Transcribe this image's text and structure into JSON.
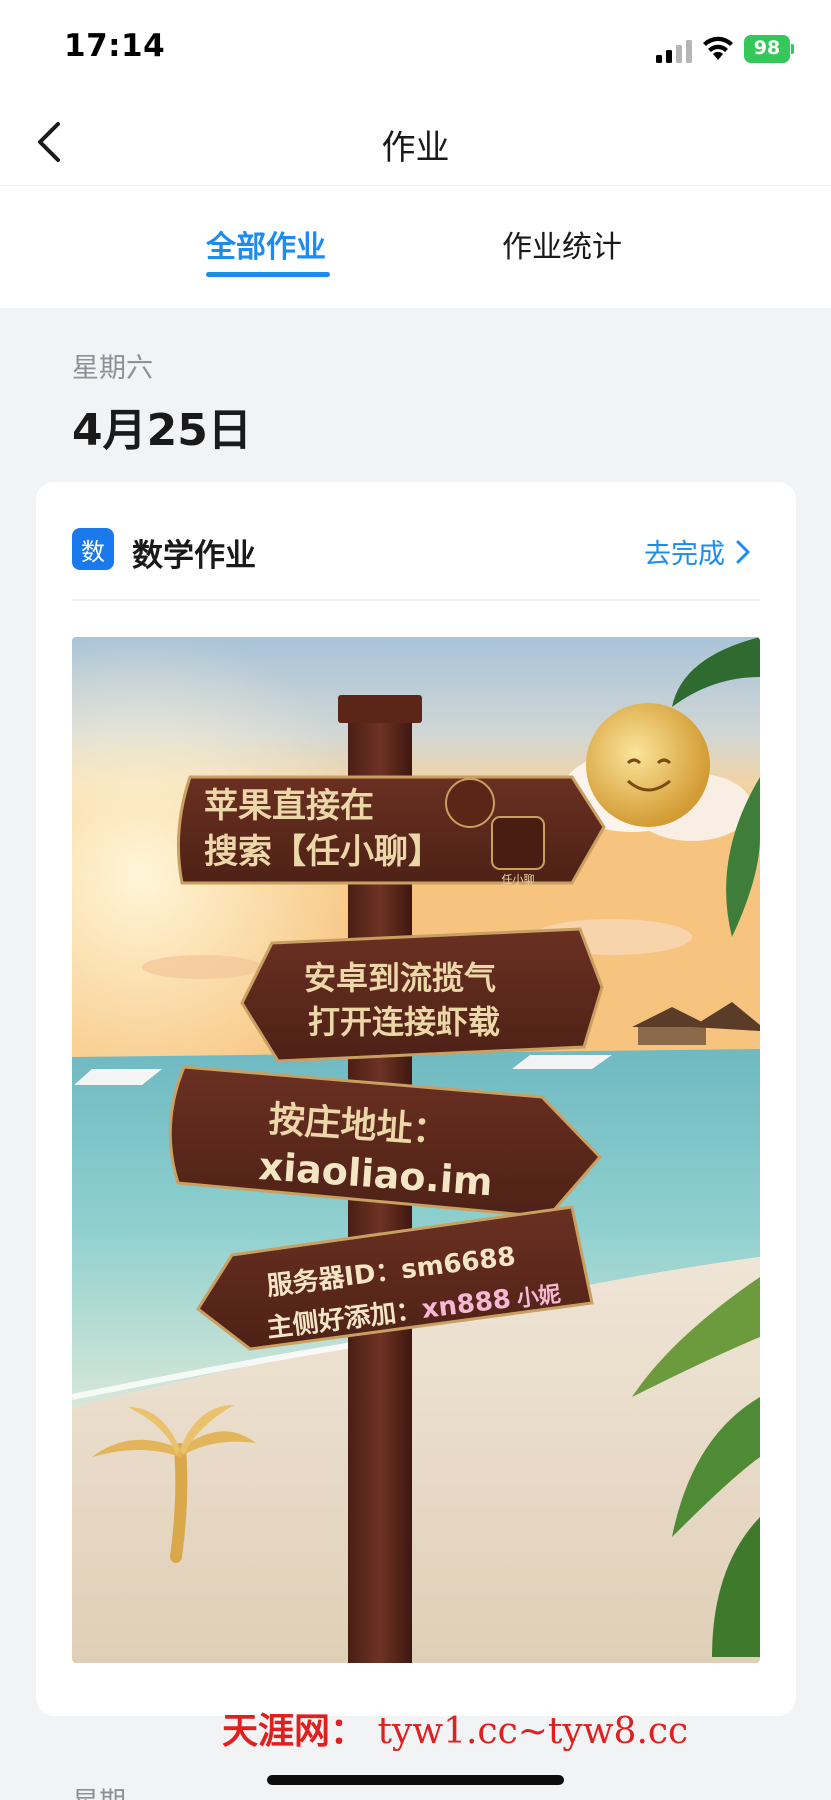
{
  "status_bar": {
    "time": "17:14",
    "battery": "98"
  },
  "nav": {
    "title": "作业"
  },
  "tabs": [
    {
      "label": "全部作业",
      "active": true
    },
    {
      "label": "作业统计",
      "active": false
    }
  ],
  "day": {
    "weekday": "星期六",
    "date": "4月25日"
  },
  "card": {
    "subject_icon_char": "数",
    "subject_name": "数学作业",
    "action_label": "去完成",
    "image": {
      "sign1_line1": "苹果直接在",
      "sign1_line2": "搜索【任小聊】",
      "sign1_app_caption": "任小聊",
      "sign2_line1": "安卓到流揽气",
      "sign2_line2": "打开连接虾载",
      "sign3_line1": "按庄地址：",
      "sign3_line2": "xiaoliao.im",
      "sign4_line1": "服务器ID：sm6688",
      "sign4_line2_prefix": "主侧好添加：",
      "sign4_line2_id": "xn888",
      "sign4_line2_name": "小妮"
    }
  },
  "next_day": {
    "weekday": "星期"
  },
  "watermark": {
    "site_name": "天涯网：",
    "urls": "tyw1.cc~tyw8.cc"
  },
  "colors": {
    "accent": "#1b8cf0",
    "background": "#f2f3f5",
    "battery": "#35c759",
    "watermark": "#e0201f"
  }
}
